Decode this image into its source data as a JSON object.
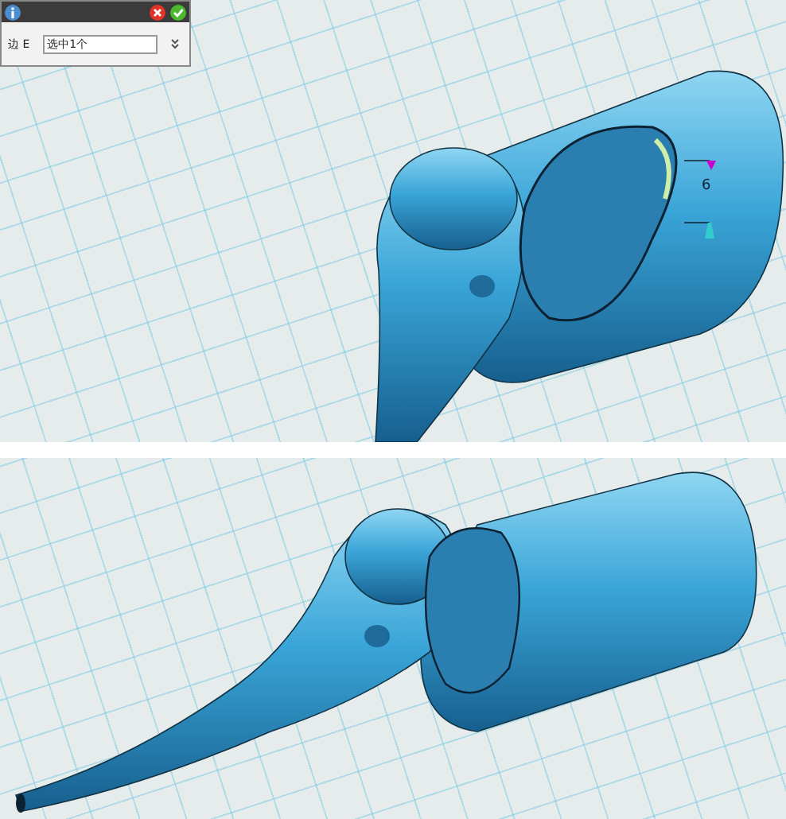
{
  "top_viewport": {
    "dialog": {
      "field_label": "边 E",
      "field_value": "选中1个"
    },
    "dimension_label": "6"
  }
}
